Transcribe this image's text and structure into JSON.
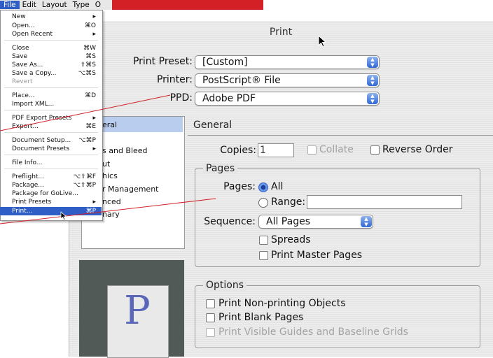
{
  "menubar": {
    "items": [
      "File",
      "Edit",
      "Layout",
      "Type",
      "O"
    ],
    "accent": "#d32026",
    "selected": "File"
  },
  "file_menu": {
    "items": [
      {
        "label": "New",
        "shortcut": "▸",
        "disabled": false
      },
      {
        "label": "Open...",
        "shortcut": "⌘O",
        "disabled": false
      },
      {
        "label": "Open Recent",
        "shortcut": "▸",
        "disabled": false
      },
      {
        "label": "Close",
        "shortcut": "⌘W",
        "disabled": false
      },
      {
        "label": "Save",
        "shortcut": "⌘S",
        "disabled": false
      },
      {
        "label": "Save As...",
        "shortcut": "⇧⌘S",
        "disabled": false
      },
      {
        "label": "Save a Copy...",
        "shortcut": "⌥⌘S",
        "disabled": false
      },
      {
        "label": "Revert",
        "shortcut": "",
        "disabled": true
      },
      {
        "label": "Place...",
        "shortcut": "⌘D",
        "disabled": false
      },
      {
        "label": "Import XML...",
        "shortcut": "",
        "disabled": false
      },
      {
        "label": "PDF Export Presets",
        "shortcut": "▸",
        "disabled": false
      },
      {
        "label": "Export...",
        "shortcut": "⌘E",
        "disabled": false
      },
      {
        "label": "Document Setup...",
        "shortcut": "⌥⌘P",
        "disabled": false
      },
      {
        "label": "Document Presets",
        "shortcut": "▸",
        "disabled": false
      },
      {
        "label": "File Info...",
        "shortcut": "",
        "disabled": false
      },
      {
        "label": "Preflight...",
        "shortcut": "⌥⇧⌘F",
        "disabled": false
      },
      {
        "label": "Package...",
        "shortcut": "⌥⇧⌘P",
        "disabled": false
      },
      {
        "label": "Package for GoLive...",
        "shortcut": "",
        "disabled": false
      },
      {
        "label": "Print Presets",
        "shortcut": "▸",
        "disabled": false
      },
      {
        "label": "Print...",
        "shortcut": "⌘P",
        "disabled": false,
        "highlighted": true
      }
    ]
  },
  "dialog": {
    "title": "Print",
    "print_preset_label": "Print Preset:",
    "print_preset_value": "[Custom]",
    "printer_label": "Printer:",
    "printer_value": "PostScript® File",
    "ppd_label": "PPD:",
    "ppd_value": "Adobe PDF",
    "sidebar_items": [
      "eral",
      "s and Bleed",
      "ut",
      "hics",
      "r Management",
      "nced",
      "nary"
    ],
    "preview_letter": "P",
    "section_title": "General",
    "copies_label": "Copies:",
    "copies_value": "1",
    "collate_label": "Collate",
    "reverse_order_label": "Reverse Order",
    "pages_group_title": "Pages",
    "pages_label": "Pages:",
    "all_label": "All",
    "range_label": "Range:",
    "range_value": "",
    "sequence_label": "Sequence:",
    "sequence_value": "All Pages",
    "spreads_label": "Spreads",
    "print_master_pages_label": "Print Master Pages",
    "options_group_title": "Options",
    "opt_non_printing": "Print Non-printing Objects",
    "opt_blank_pages": "Print Blank Pages",
    "opt_guides": "Print Visible Guides and Baseline Grids"
  },
  "colors": {
    "selection_blue": "#2f5ec6",
    "annotation_red": "#d32026",
    "preview_bg": "#525a58"
  }
}
